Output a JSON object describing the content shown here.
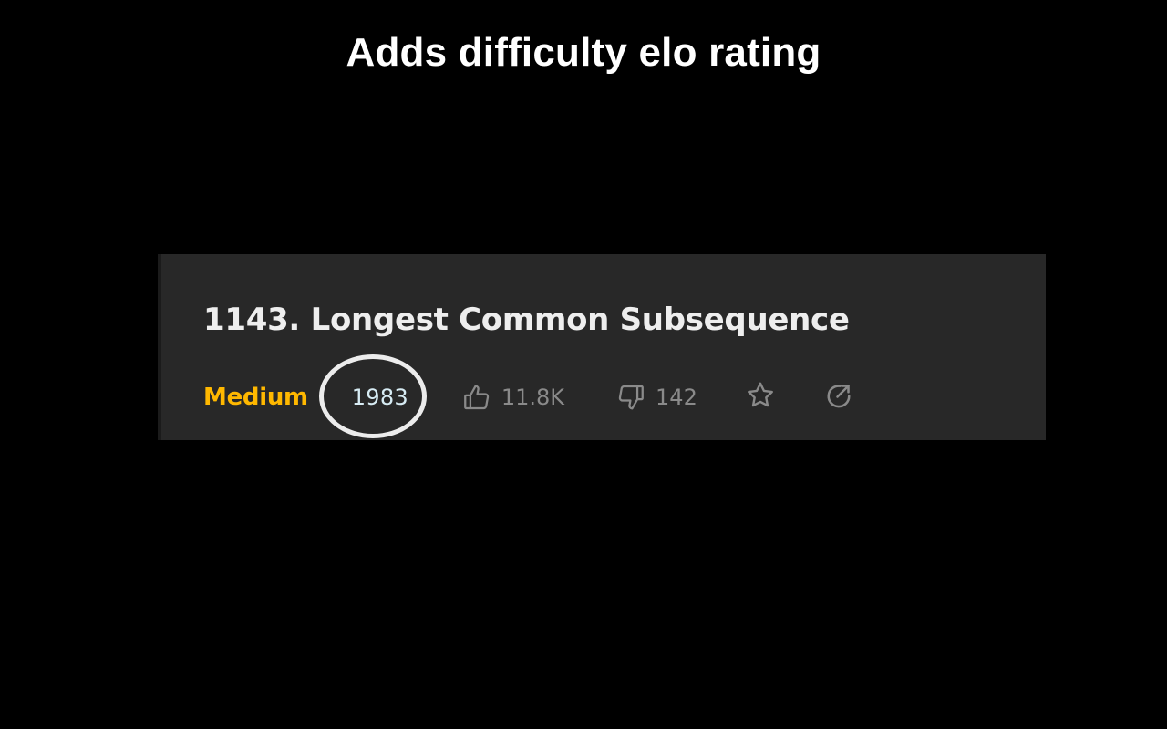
{
  "headline": "Adds difficulty elo rating",
  "problem": {
    "title": "1143. Longest Common Subsequence",
    "difficulty": "Medium",
    "rating": "1983",
    "likes": "11.8K",
    "dislikes": "142"
  },
  "icons": {
    "like": "thumbs-up-icon",
    "dislike": "thumbs-down-icon",
    "favorite": "star-icon",
    "share": "share-icon"
  },
  "colors": {
    "background": "#000000",
    "panel": "#282828",
    "difficulty_medium": "#ffb800",
    "rating_text": "#d7ecf4",
    "highlight_ring": "#ececec",
    "muted": "#8a8a8a"
  }
}
